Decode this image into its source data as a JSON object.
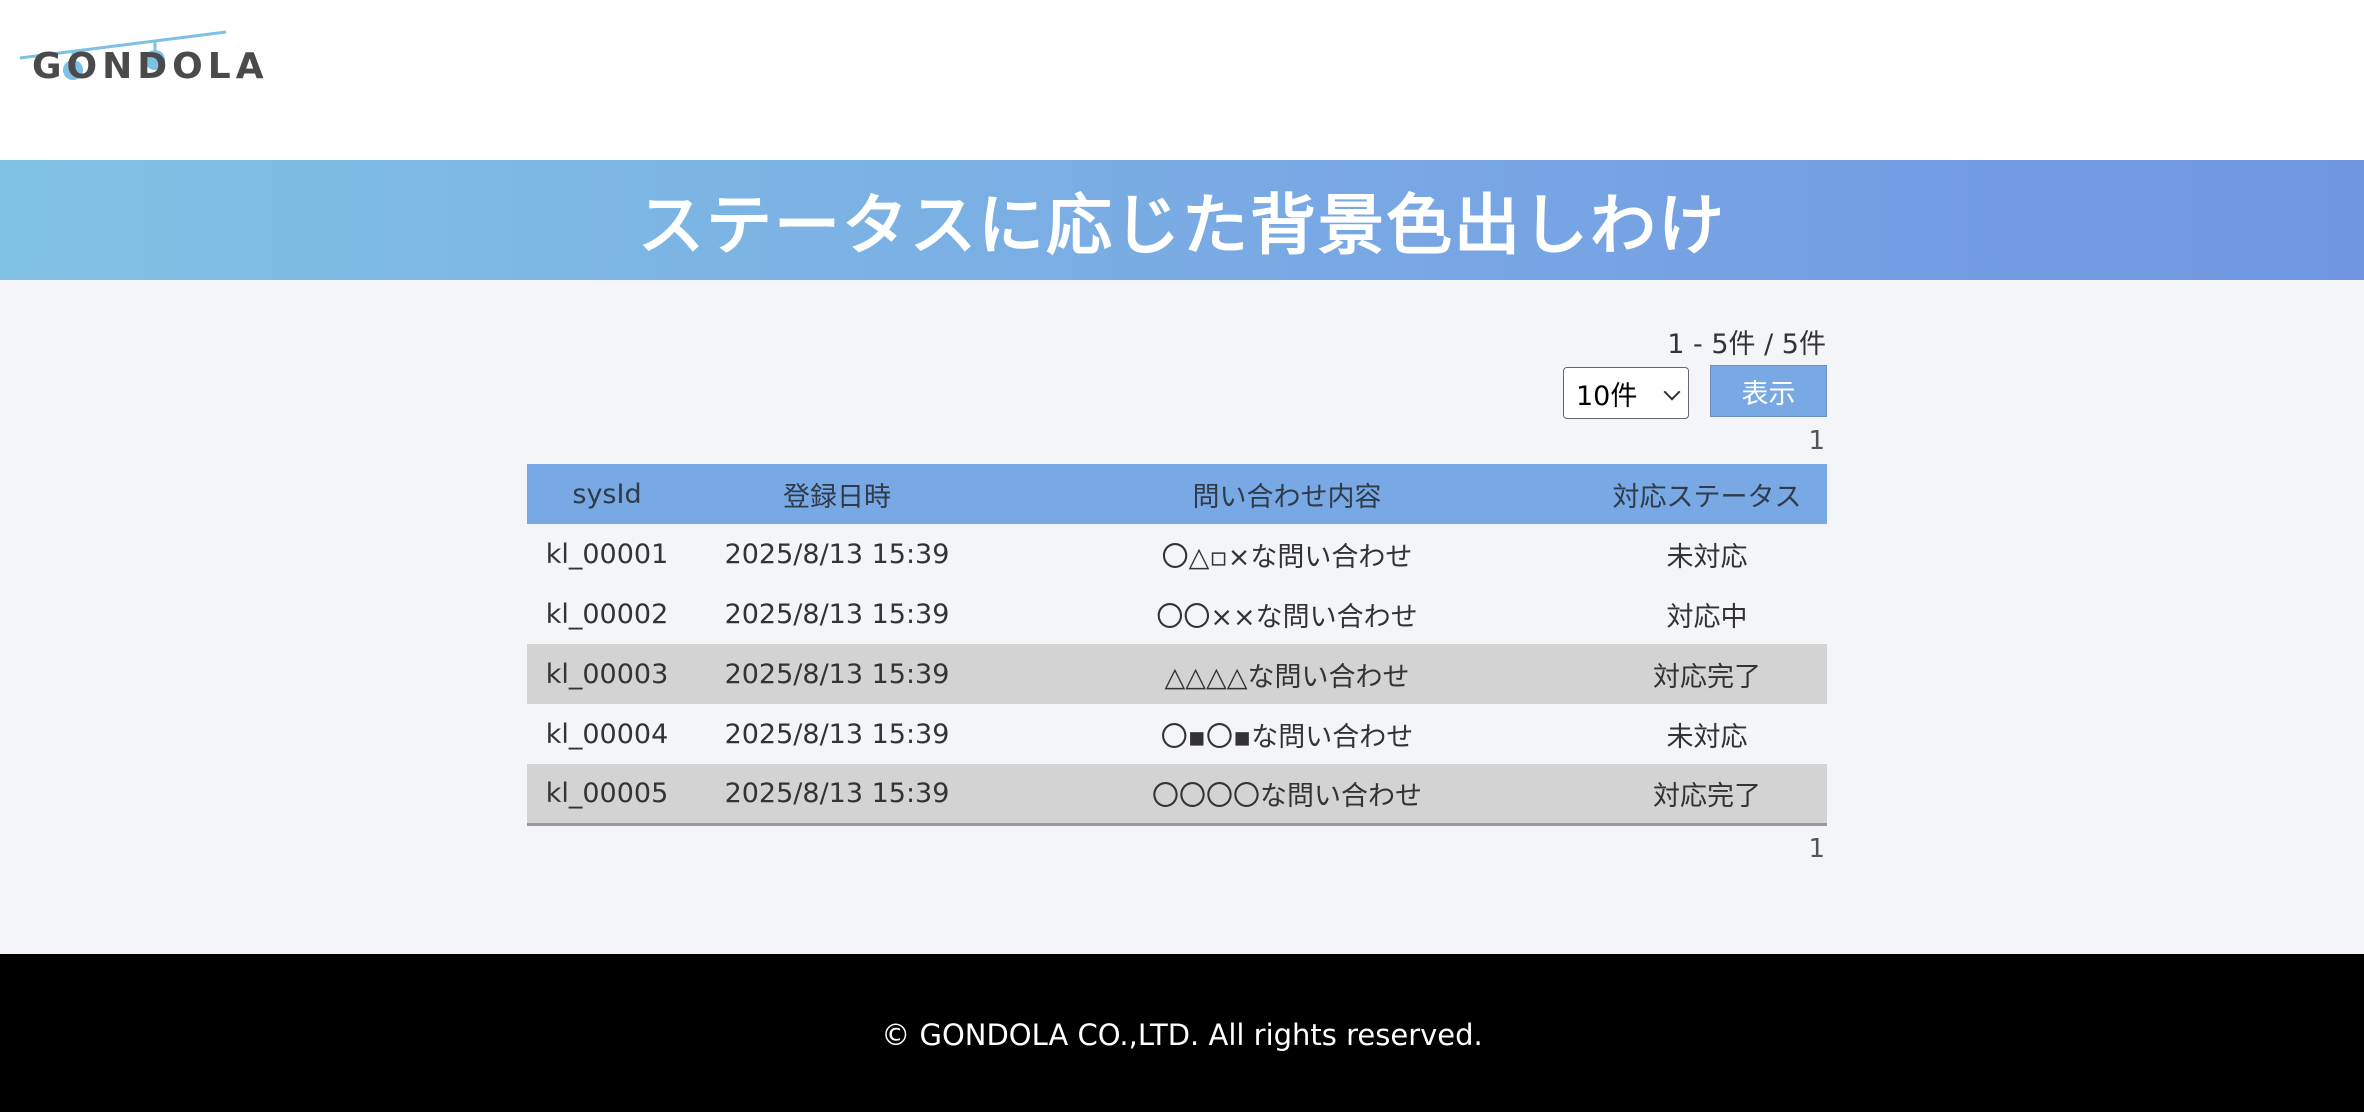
{
  "header": {
    "logo_text": "GONDOLA"
  },
  "banner": {
    "title": "ステータスに応じた背景色出しわけ"
  },
  "controls": {
    "count_text": "1 - 5件 / 5件",
    "per_page_value": "10件",
    "show_button": "表示",
    "pager_top": "1",
    "pager_bottom": "1"
  },
  "table": {
    "headers": [
      "sysId",
      "登録日時",
      "問い合わせ内容",
      "対応ステータス"
    ],
    "rows": [
      {
        "id": "kl_00001",
        "date": "2025/8/13 15:39",
        "content": "〇△▫×な問い合わせ",
        "status": "未対応"
      },
      {
        "id": "kl_00002",
        "date": "2025/8/13 15:39",
        "content": "〇〇××な問い合わせ",
        "status": "対応中"
      },
      {
        "id": "kl_00003",
        "date": "2025/8/13 15:39",
        "content": "△△△△な問い合わせ",
        "status": "対応完了"
      },
      {
        "id": "kl_00004",
        "date": "2025/8/13 15:39",
        "content": "〇▪〇▪な問い合わせ",
        "status": "未対応"
      },
      {
        "id": "kl_00005",
        "date": "2025/8/13 15:39",
        "content": "〇〇〇〇な問い合わせ",
        "status": "対応完了"
      }
    ]
  },
  "footer": {
    "copyright": "© GONDOLA CO.,LTD. All rights reserved."
  },
  "colors": {
    "accent": "#79a9e4",
    "done_row": "#d3d3d3",
    "footer_bg": "#000000"
  }
}
